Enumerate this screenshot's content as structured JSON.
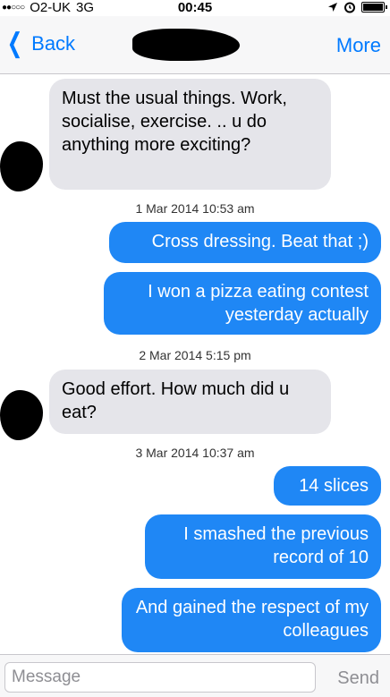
{
  "status_bar": {
    "carrier": "O2-UK",
    "network": "3G",
    "time": "00:45",
    "icons": [
      "signal-dots-icon",
      "location-arrow-icon",
      "alarm-icon",
      "battery-icon"
    ]
  },
  "nav": {
    "back_label": "Back",
    "more_label": "More"
  },
  "messages": [
    {
      "direction": "incoming",
      "text": "Must the usual things. Work, socialise,  exercise. .. u do anything more exciting?"
    },
    {
      "type": "timestamp",
      "text": "1 Mar 2014 10:53 am"
    },
    {
      "direction": "outgoing",
      "text": "Cross dressing. Beat that ;)"
    },
    {
      "direction": "outgoing",
      "text": "I won a pizza eating contest yesterday actually"
    },
    {
      "type": "timestamp",
      "text": "2 Mar 2014 5:15 pm"
    },
    {
      "direction": "incoming",
      "text": "Good effort.  How much did u eat?"
    },
    {
      "type": "timestamp",
      "text": "3 Mar 2014 10:37 am"
    },
    {
      "direction": "outgoing",
      "text": "14 slices"
    },
    {
      "direction": "outgoing",
      "text": "I smashed the previous record of 10"
    },
    {
      "direction": "outgoing",
      "text": "And gained the respect of my colleagues"
    }
  ],
  "composer": {
    "placeholder": "Message",
    "send_label": "Send"
  },
  "colors": {
    "outgoing_bubble": "#1f87f5",
    "incoming_bubble": "#e5e5ea",
    "accent": "#007aff"
  }
}
